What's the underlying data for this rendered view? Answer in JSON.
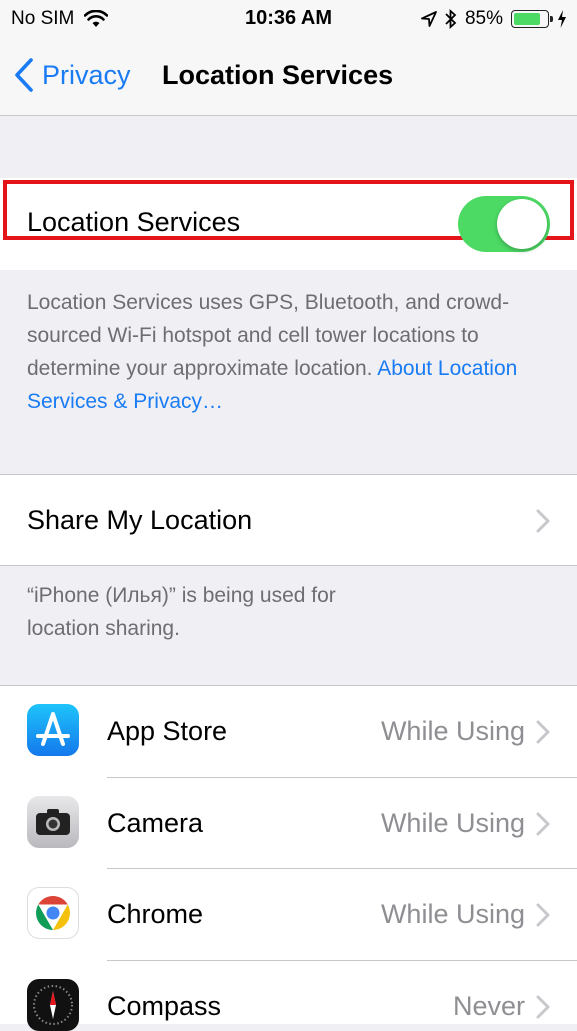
{
  "status_bar": {
    "carrier": "No SIM",
    "time": "10:36 AM",
    "battery_percent": "85%",
    "battery_level": 0.85,
    "icons": [
      "wifi-icon",
      "location-arrow-icon",
      "bluetooth-icon",
      "battery-icon",
      "charging-icon"
    ]
  },
  "nav": {
    "back_label": "Privacy",
    "title": "Location Services"
  },
  "location_services": {
    "label": "Location Services",
    "toggle_on": true,
    "description": "Location Services uses GPS, Bluetooth, and crowd-sourced Wi-Fi hotspot and cell tower locations to determine your approximate location.",
    "link": "About Location Services & Privacy…"
  },
  "share": {
    "label": "Share My Location",
    "footer": "“iPhone (Илья)” is being used for location sharing."
  },
  "apps": [
    {
      "name": "App Store",
      "value": "While Using",
      "icon": "app-store-icon"
    },
    {
      "name": "Camera",
      "value": "While Using",
      "icon": "camera-icon"
    },
    {
      "name": "Chrome",
      "value": "While Using",
      "icon": "chrome-icon"
    },
    {
      "name": "Compass",
      "value": "Never",
      "icon": "compass-icon"
    }
  ],
  "colors": {
    "accent": "#1a7cf4",
    "toggle_on": "#4cd964",
    "highlight": "#e4141b",
    "background": "#efeff4"
  }
}
